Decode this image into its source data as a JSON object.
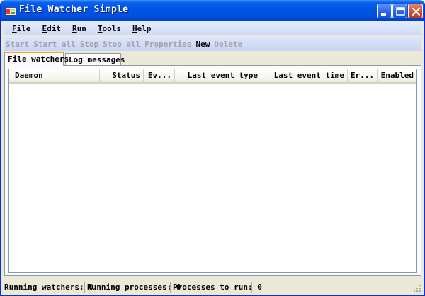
{
  "window": {
    "title": "File Watcher Simple"
  },
  "menu": [
    {
      "label": "File",
      "underline": "F",
      "rest": "ile"
    },
    {
      "label": "Edit",
      "underline": "E",
      "rest": "dit"
    },
    {
      "label": "Run",
      "underline": "R",
      "rest": "un"
    },
    {
      "label": "Tools",
      "underline": "T",
      "rest": "ools"
    },
    {
      "label": "Help",
      "underline": "H",
      "rest": "elp"
    }
  ],
  "toolbar": {
    "start": "Start",
    "start_all": "Start all",
    "stop": "Stop",
    "stop_all": "Stop all",
    "properties": "Properties",
    "new": "New",
    "delete": "Delete"
  },
  "tabs": {
    "file_watchers": "File watchers",
    "log_messages": "Log messages"
  },
  "table": {
    "columns": {
      "daemon": "Daemon",
      "status": "Status",
      "events": "Ev...",
      "last_event_type": "Last event type",
      "last_event_time": "Last event time",
      "errors": "Er...",
      "enabled": "Enabled"
    },
    "rows": []
  },
  "status": {
    "running_watchers": "Running watchers: 0",
    "running_processes": "Running processes: 0",
    "processes_to_run": "Processes to run: 0"
  },
  "colors": {
    "title_bar": "#0055e5",
    "menu_bar": "#cdd9f7",
    "active_tab_accent": "#f5a623",
    "window_face": "#ece9d8"
  }
}
